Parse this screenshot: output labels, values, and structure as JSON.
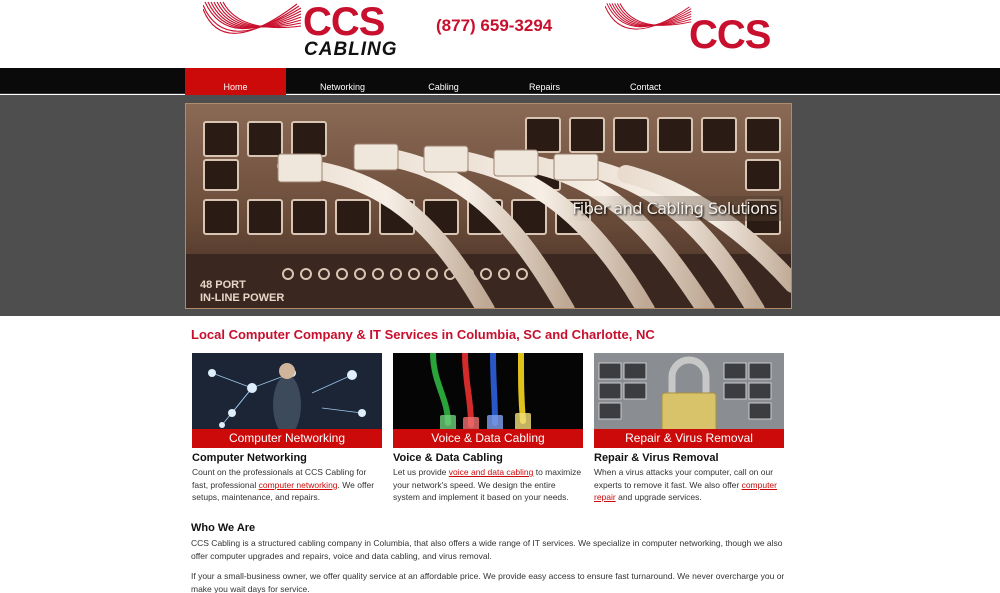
{
  "header": {
    "logo_ccs": "CCS",
    "logo_cabling": "CABLING",
    "phone": "(877) 659-3294",
    "logo_right_ccs": "CCS"
  },
  "nav": {
    "items": [
      {
        "label": "Home",
        "active": true
      },
      {
        "label": "Networking",
        "active": false
      },
      {
        "label": "Cabling",
        "active": false
      },
      {
        "label": "Repairs",
        "active": false
      },
      {
        "label": "Contact",
        "active": false
      }
    ]
  },
  "hero": {
    "caption": "Fiber and Cabling Solutions",
    "port_label_1": "48 PORT",
    "port_label_2": "IN-LINE POWER"
  },
  "main": {
    "headline": "Local Computer Company & IT Services in Columbia, SC and Charlotte, NC",
    "cards": [
      {
        "banner": "Computer Networking",
        "title": "Computer Networking",
        "text_before": "Count on the professionals at CCS Cabling for fast, professional ",
        "link": "computer networking",
        "text_after": ". We offer setups, maintenance, and repairs."
      },
      {
        "banner": "Voice & Data Cabling",
        "title": "Voice & Data Cabling",
        "text_before": "Let us provide ",
        "link": "voice and data cabling",
        "text_after": " to maximize your network's speed. We design the entire system and implement it based on your needs."
      },
      {
        "banner": "Repair & Virus Removal",
        "title": "Repair & Virus Removal",
        "text_before": "When a virus attacks your computer, call on our experts to remove it fast. We also offer ",
        "link": "computer repair",
        "text_after": " and upgrade services."
      }
    ],
    "who_title": "Who We Are",
    "who_para1": "CCS Cabling is a structured cabling company in Columbia, that also offers a wide range of IT services. We specialize in computer networking, though we also offer computer upgrades and repairs, voice and data cabling, and virus removal.",
    "who_para2": "If your a small-business owner, we offer quality service at an affordable price. We provide easy access to ensure fast turnaround. We never overcharge you or make you wait days for service."
  },
  "colors": {
    "brand_red": "#c8102e",
    "nav_bg": "#0a0a0a",
    "hero_band": "#4e4e4e"
  },
  "icons": [
    "swoosh-logo",
    "swoosh-logo"
  ]
}
